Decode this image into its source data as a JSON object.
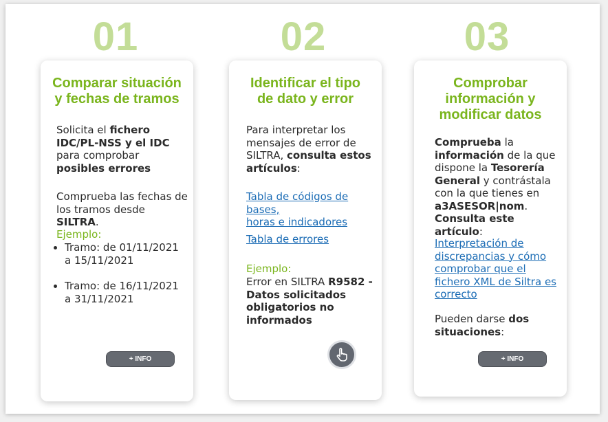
{
  "steps": [
    {
      "number": "01",
      "title_line1": "Comparar situación",
      "title_line2": "y fechas de tramos",
      "p1": {
        "l1a": "Solicita el ",
        "l1b": "fichero",
        "l2": "IDC/PL-NSS y el IDC",
        "l3": "para comprobar",
        "l4": "posibles errores"
      },
      "p2": {
        "l1": "Comprueba las fechas de",
        "l2a": "los tramos desde ",
        "l2b": "SILTRA",
        "l2c": "."
      },
      "example_label": "Ejemplo:",
      "items": [
        {
          "l1": "Tramo: de 01/11/2021",
          "l2": "a 15/11/2021"
        },
        {
          "l1": "Tramo: de 16/11/2021",
          "l2": "a 31/11/2021"
        }
      ],
      "button": "+ INFO"
    },
    {
      "number": "02",
      "title_line1": "Identificar el tipo",
      "title_line2": "de dato y error",
      "p1": {
        "l1": "Para interpretar los",
        "l2": "mensajes de error de",
        "l3a": "SILTRA, ",
        "l3b": "consulta estos",
        "l4a": "artículos",
        "l4b": ":"
      },
      "link1_l1": "Tabla de códigos de bases,",
      "link1_l2": "horas e indicadores",
      "link2": "Tabla de errores",
      "example_label": "Ejemplo:",
      "example": {
        "l1a": "Error en SILTRA ",
        "l1b": "R9582 -",
        "l2": "Datos solicitados",
        "l3": "obligatorios no",
        "l4": "informados"
      }
    },
    {
      "number": "03",
      "title_line1": "Comprobar",
      "title_line2": "información y",
      "title_line3": "modificar datos",
      "p1": {
        "l1a": "Comprueba",
        "l1b": " la",
        "l2a": "información",
        "l2b": " de la que",
        "l3a": "dispone la ",
        "l3b": "Tesorería",
        "l4a": "General",
        "l4b": " y contrástala",
        "l5": "con la que tienes en",
        "l6a": "a3ASESOR|nom",
        "l6b": ".",
        "l7a": "Consulta este artículo",
        "l7b": ":"
      },
      "link_l1": "Interpretación de",
      "link_l2": "discrepancias y cómo",
      "link_l3": "comprobar que el",
      "link_l4": "fichero XML de Siltra es",
      "link_l5": "correcto",
      "p2": {
        "l1a": "Pueden darse ",
        "l1b": "dos",
        "l2": "situaciones",
        "l2b": ":"
      },
      "button": "+ INFO"
    }
  ],
  "colors": {
    "accent": "#7ab51d",
    "number": "#c3dd97",
    "link": "#1b6cb5",
    "button": "#666a71"
  },
  "icons": {
    "tap": "hand-pointer-icon"
  }
}
